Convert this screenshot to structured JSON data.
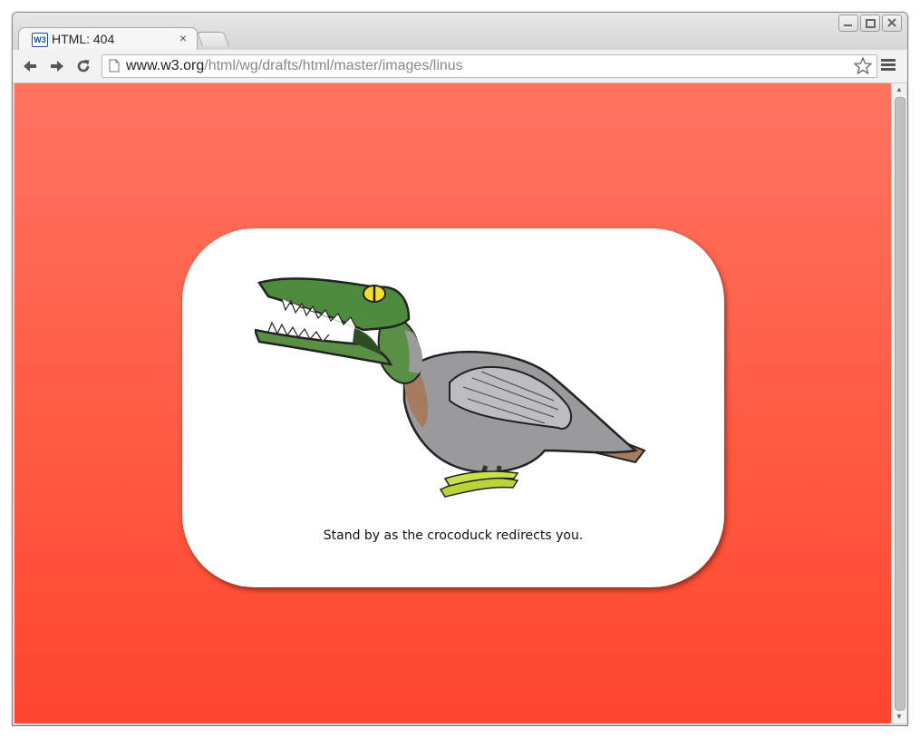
{
  "browser": {
    "tab": {
      "favicon_text": "W3",
      "title": "HTML: 404",
      "close_glyph": "×"
    },
    "window_controls": [
      "minimize-icon",
      "maximize-icon",
      "close-icon"
    ],
    "toolbar": {
      "back_icon": "back-arrow-icon",
      "forward_icon": "forward-arrow-icon",
      "reload_icon": "reload-icon",
      "url_host": "www.w3.org",
      "url_path": "/html/wg/drafts/html/master/images/linus",
      "bookmark_icon": "star-icon",
      "menu_icon": "hamburger-menu-icon"
    }
  },
  "page": {
    "illustration": "crocoduck-illustration",
    "caption": "Stand by as the crocoduck redirects you.",
    "colors": {
      "background_top": "#ff7461",
      "background_bottom": "#ff462e",
      "card": "#ffffff"
    }
  }
}
